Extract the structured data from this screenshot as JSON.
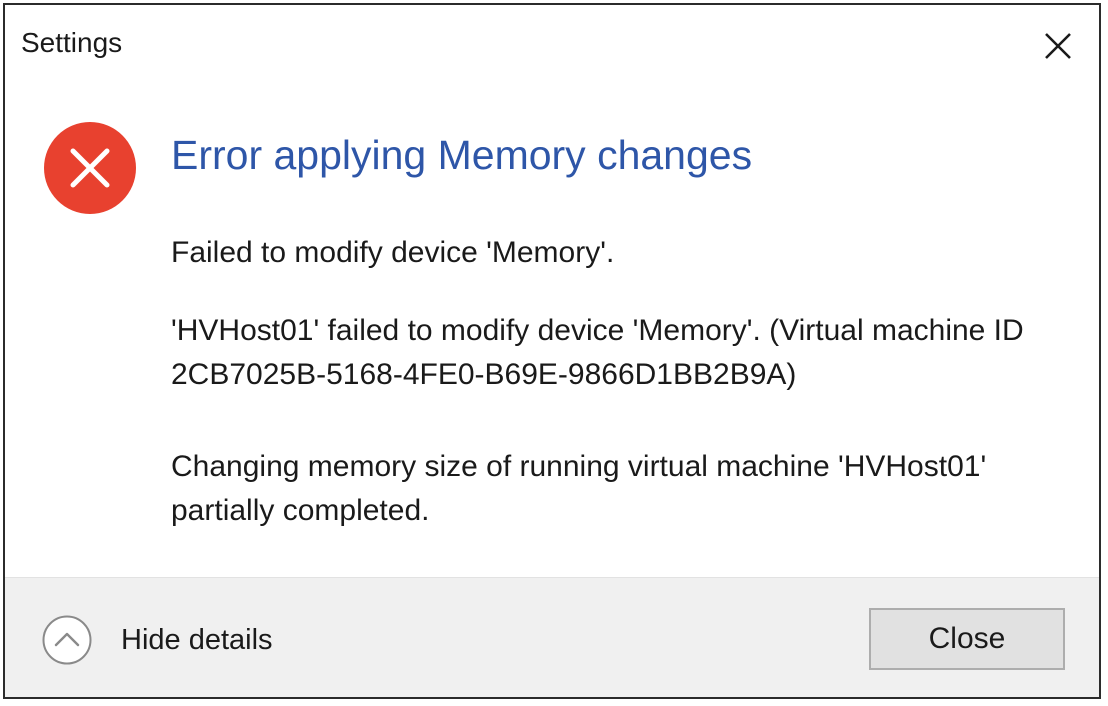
{
  "window": {
    "title": "Settings",
    "close_icon": "close-icon"
  },
  "error": {
    "icon": "error-icon",
    "icon_color": "#e8412f",
    "heading": "Error applying Memory changes",
    "heading_color": "#2e56a8",
    "messages": [
      "Failed to modify device 'Memory'.",
      "'HVHost01' failed to modify device 'Memory'. (Virtual machine ID 2CB7025B-5168-4FE0-B69E-9866D1BB2B9A)",
      "Changing memory size of running virtual machine 'HVHost01' partially completed."
    ]
  },
  "footer": {
    "toggle_icon": "chevron-up-icon",
    "toggle_label": "Hide details",
    "close_button_label": "Close"
  }
}
